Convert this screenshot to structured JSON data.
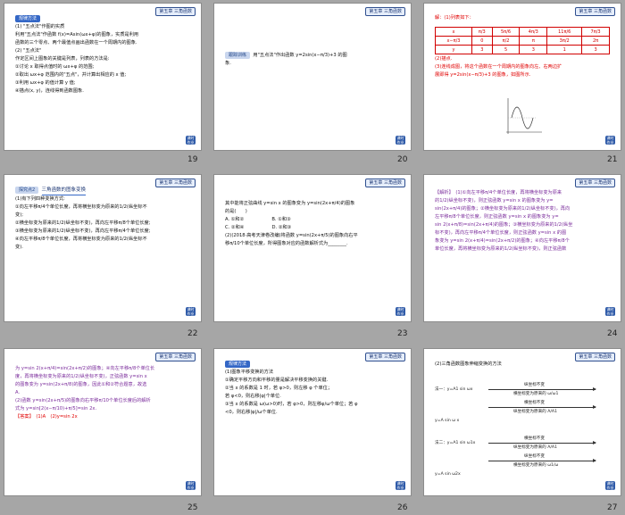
{
  "tag_label": "第五章 三角函数",
  "corner_label": "课时作业",
  "slides": [
    {
      "number": "19",
      "header": "规律方法",
      "lines": [
        "(1) \"五点法\"作图的实质",
        "利用\"五点法\"作函数 f(x)=Asin(ωx+φ)的图象，实质是利用",
        "函数的三个零点、两个最值点画出函数在一个周期内的图象.",
        "(2) \"五点法\"",
        "作定区间上图象的关键是列表，列表的方法是:",
        "①讨论 x 取得点值时的 ωx+φ 的范围;",
        "②取出 ωx+φ 范围内的\"五点\"，并计算出相应的 x 值;",
        "③利用 ωx+φ 的值计算 y 值;",
        "④描点(x, y)，连线得到函数图象."
      ]
    },
    {
      "number": "20",
      "header": "跟踪训练",
      "lines": [
        "用\"五点法\"作出函数 y=2sin(x−π/3)+3 的图",
        "象."
      ]
    },
    {
      "number": "21",
      "lines_top": [
        "解：(1)列表如下："
      ],
      "table": [
        [
          "x",
          "π/3",
          "5π/6",
          "4π/3",
          "11π/6",
          "7π/3"
        ],
        [
          "x−π/3",
          "0",
          "π/2",
          "π",
          "3π/2",
          "2π"
        ],
        [
          "y",
          "3",
          "5",
          "3",
          "1",
          "3"
        ]
      ],
      "lines_bottom": [
        "(2)描点.",
        "(3)连线成图，将这个函数在一个周期内的图象向左、右两边扩",
        "展即得 y=2sin(x−π/3)+3 的图象，如图所示."
      ]
    },
    {
      "number": "22",
      "section_label": "探究点2",
      "section_title": "三角函数的图象变换",
      "lines": [
        "(1)有下列四种变换方式:",
        "①向左平移π/4个单位长度，再将横坐标变为原来的1/2(纵坐标不",
        "变);",
        "②横坐标变为原来的1/2(纵坐标不变)，再向左平移π/8个单位长度;",
        "③横坐标变为原来的1/2(纵坐标不变)，再向左平移π/4个单位长度;",
        "④向左平移π/8个单位长度，再将横坐标变为原来的1/2(纵坐标不",
        "变)."
      ]
    },
    {
      "number": "23",
      "lines": [
        "其中能将正弦曲线 y=sin x 的图象变为 y=sin(2x+π/4)的图象",
        "的是(　　)",
        "A. ①和②　　　　　　B. ①和③",
        "C. ②和④　　　　　　D. ②和③",
        "(2)(2018·高考天津卷改编)将函数 y=sin(2x+π/5)的图象向右平",
        "移π/10个单位长度，所得图象对应的函数解析式为________."
      ]
    },
    {
      "number": "24",
      "lines": [
        "【解析】　(1)①向左平移π/4个单位长度，再将横坐标变为原来",
        "的1/2(纵坐标不变)，则正弦函数 y=sin x 的图象变为 y=",
        "sin(2x+π/4)的图象；②横坐标变为原来的1/2(纵坐标不变)，再向",
        "左平移π/8个单位长度，则正弦函数 y=sin x 的图象变为 y=",
        "sin 2(x+π/8)=sin(2x+π/4)的图象；③横坐标变为原来的1/2(纵坐",
        "标不变)，再向左平移π/4个单位长度，则正弦函数 y=sin x 的图",
        "象变为 y=sin 2(x+π/4)=sin(2x+π/2)的图象；④向左平移π/8个",
        "单位长度，再将横坐标变为原来的1/2(纵坐标不变)，则正弦函数"
      ]
    },
    {
      "number": "25",
      "lines": [
        "为 y=sin 2(x+π/4)=sin(2x+π/2)的图象；④向左平移π/8个单位长",
        "度，再将横坐标变为原来的1/2(纵坐标不变)，正弦函数 y=sin x",
        "的图象变为 y=sin(2x+π/8)的图象，因此①和②符合题意，故选",
        "A.",
        "(2)函数 y=sin(2x+π/5)的图象向右平移π/10个单位长度后的解析",
        "式为 y=sin[2(x−π/10)+π/5]=sin 2x."
      ],
      "answer": "【答案】　(1)A　(2)y=sin 2x"
    },
    {
      "number": "26",
      "header": "规律方法",
      "lines": [
        "(1)图象平移变换的方法",
        "①确定平移方向和平移的量是解决平移变换的关键.",
        "②当 x 的系数是 1 时，若 φ>0，则左移 φ 个单位；",
        "若 φ<0，则右移|φ|个单位.",
        "③当 x 的系数是 ω(ω>0)时，若 φ>0，则左移φ/ω个单位；若 φ",
        "<0，则右移|φ|/ω个单位."
      ]
    },
    {
      "number": "27",
      "title": "(2)三角函数图象伸缩变换的方法",
      "method1": "法一：y=A1 sin ωx",
      "labels1": [
        "纵坐标不变",
        "横坐标变为原来的 ω/ω1",
        "横坐标不变",
        "纵坐标变为原来的 A/A1"
      ],
      "result1": "y=A sin ω x",
      "method2": "法二：y=A1 sin ω1x",
      "labels2": [
        "横坐标不变",
        "纵坐标变为原来的 A/A1",
        "纵坐标不变",
        "横坐标变为原来的 ω1/ω"
      ],
      "result2": "y=A sin ω2x"
    }
  ]
}
